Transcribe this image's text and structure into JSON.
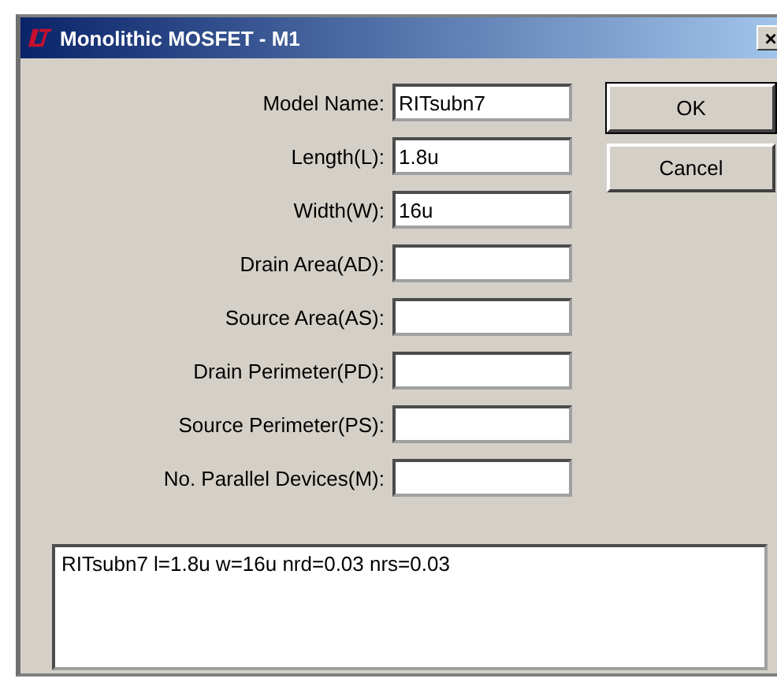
{
  "window": {
    "title": "Monolithic MOSFET - M1",
    "close": "×"
  },
  "fields": [
    {
      "label": "Model Name:",
      "value": "RITsubn7"
    },
    {
      "label": "Length(L):",
      "value": "1.8u"
    },
    {
      "label": "Width(W):",
      "value": "16u"
    },
    {
      "label": "Drain Area(AD):"
    },
    {
      "label": "Source Area(AS):"
    },
    {
      "label": "Drain Perimeter(PD):"
    },
    {
      "label": "Source Perimeter(PS):"
    },
    {
      "label": "No. Parallel Devices(M):"
    }
  ],
  "buttons": [
    {
      "label": "OK",
      "default": true
    },
    {
      "label": "Cancel",
      "default": false
    }
  ],
  "preview": "RITsubn7 l=1.8u w=16u nrd=0.03 nrs=0.03"
}
